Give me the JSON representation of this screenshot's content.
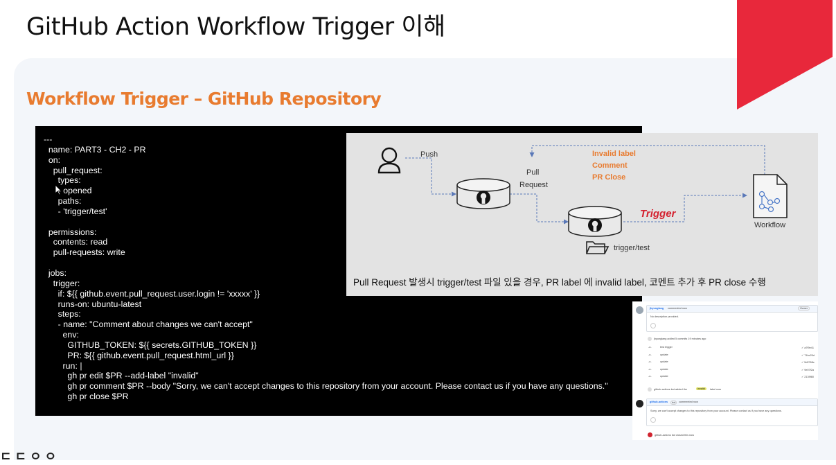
{
  "slide": {
    "title": "GitHub Action  Workflow Trigger 이해",
    "section_title": "Workflow Trigger – GitHub Repository",
    "corner_text": "ㄷ  ㄷ ㅇ ㅇ"
  },
  "code": {
    "lines": [
      "---",
      "  name: PART3 - CH2 - PR",
      "  on:",
      "    pull_request:",
      "      types:",
      "      - opened",
      "      paths:",
      "      - 'trigger/test'",
      "",
      "  permissions:",
      "    contents: read",
      "    pull-requests: write",
      "",
      "  jobs:",
      "    trigger:",
      "      if: ${{ github.event.pull_request.user.login != 'xxxxx' }}",
      "      runs-on: ubuntu-latest",
      "      steps:",
      "      - name: \"Comment about changes we can't accept\"",
      "        env:",
      "          GITHUB_TOKEN: ${{ secrets.GITHUB_TOKEN }}",
      "          PR: ${{ github.event.pull_request.html_url }}",
      "        run: |",
      "          gh pr edit $PR --add-label \"invalid\"",
      "          gh pr comment $PR --body \"Sorry, we can't accept changes to this repository from your account. Please contact us if you have any questions.\"",
      "          gh pr close $PR"
    ]
  },
  "diagram": {
    "push_label": "Push",
    "pull_request_label_1": "Pull",
    "pull_request_label_2": "Request",
    "invalid_label": "Invalid label",
    "comment_label": "Comment",
    "pr_close_label": "PR Close",
    "trigger_label": "Trigger",
    "workflow_label": "Workflow",
    "folder_label": "trigger/test",
    "caption": "Pull Request 발생시 trigger/test 파일 있을 경우, PR label 에 invalid label, 코멘트 추가 후 PR close 수행"
  },
  "pr_screenshot": {
    "author_1": "jhyunglang",
    "commented_1": "commented now",
    "owner_badge": "Owner",
    "no_description": "No description provided.",
    "commits_header": "jhyunglang added 5 commits 19 minutes ago",
    "commits": [
      {
        "msg": "test trigger",
        "sha": "✓ a7f9e41"
      },
      {
        "msg": "update",
        "sha": "✓ 71bc25d"
      },
      {
        "msg": "update",
        "sha": "✓ 5d2768c"
      },
      {
        "msg": "update",
        "sha": "✓ 9e07f2a"
      },
      {
        "msg": "update",
        "sha": "✓ 2139f80"
      }
    ],
    "label_event_pre": "github-actions bot added the",
    "label_name": "invalid",
    "label_event_post": "label now",
    "author_2": "github-actions",
    "bot_badge": "bot",
    "commented_2": "commented now",
    "bot_comment": "Sorry, we can't accept changes to this repository from your account. Please contact us if you have any questions.",
    "closed_event": "github-actions bot closed this now"
  }
}
